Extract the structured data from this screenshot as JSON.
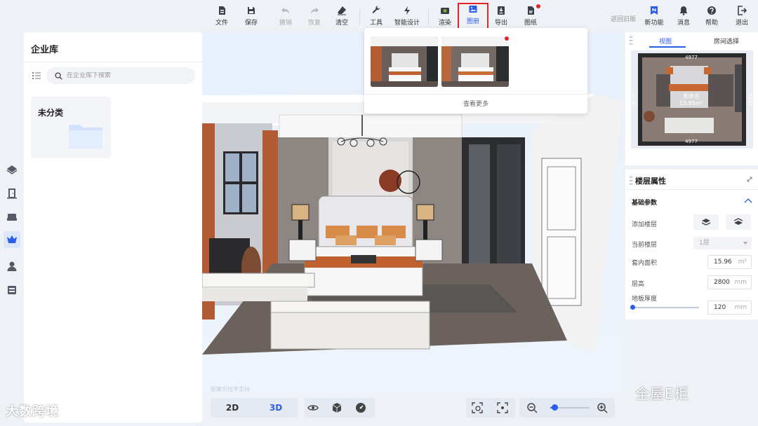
{
  "toolbar": {
    "items": [
      {
        "label": "文件",
        "icon": "file-icon"
      },
      {
        "label": "保存",
        "icon": "save-icon"
      },
      {
        "label": "撤销",
        "icon": "undo-icon",
        "disabled": true
      },
      {
        "label": "恢复",
        "icon": "redo-icon",
        "disabled": true
      },
      {
        "label": "清空",
        "icon": "eraser-icon"
      },
      {
        "label": "工具",
        "icon": "wrench-icon"
      },
      {
        "label": "智能设计",
        "icon": "lightning-icon"
      },
      {
        "label": "渲染",
        "icon": "camera-icon"
      },
      {
        "label": "图册",
        "icon": "image-album-icon",
        "active": true
      },
      {
        "label": "导出",
        "icon": "export-icon"
      },
      {
        "label": "图纸",
        "icon": "drawing-icon"
      }
    ],
    "back_to_old": "返回旧版",
    "right_items": [
      {
        "label": "新功能",
        "icon": "new-feature-icon"
      },
      {
        "label": "消息",
        "icon": "bell-icon"
      },
      {
        "label": "帮助",
        "icon": "help-icon"
      },
      {
        "label": "退出",
        "icon": "logout-icon"
      }
    ]
  },
  "library": {
    "title": "企业库",
    "search_placeholder": "在企业库下搜索",
    "folders": [
      {
        "name": "未分类"
      }
    ]
  },
  "album_popup": {
    "thumbnails": [
      "bedroom-render-1",
      "bedroom-render-2"
    ],
    "view_more": "查看更多"
  },
  "bottom": {
    "view_modes": [
      "2D",
      "3D"
    ],
    "active_mode": "3D",
    "supplier_text": "图案乐技术支持",
    "zoom_level": 0.1
  },
  "view_panel": {
    "tabs": [
      "视图",
      "房间选择"
    ],
    "active_tab": "视图",
    "plan": {
      "room_name": "未命名",
      "room_area": "15.85m²",
      "dim_top": "4977",
      "dim_bottom": "4977",
      "dim_left": "3222",
      "dim_right": "3222"
    }
  },
  "floor_props": {
    "title": "楼层属性",
    "section": "基础参数",
    "add_floor_label": "添加楼层",
    "current_floor_label": "当前楼层",
    "current_floor_value": "1层",
    "inner_area_label": "套内面积",
    "inner_area_value": "15.96",
    "inner_area_unit": "m²",
    "floor_height_label": "层高",
    "floor_height_value": "2800",
    "floor_height_unit": "mm",
    "slab_label": "地板厚度",
    "slab_value": "120",
    "slab_unit": "mm"
  },
  "watermarks": {
    "left": "大数跨境",
    "right": "全屋E柜"
  },
  "colors": {
    "accent": "#2b5ee8",
    "highlight": "#e0262a"
  }
}
